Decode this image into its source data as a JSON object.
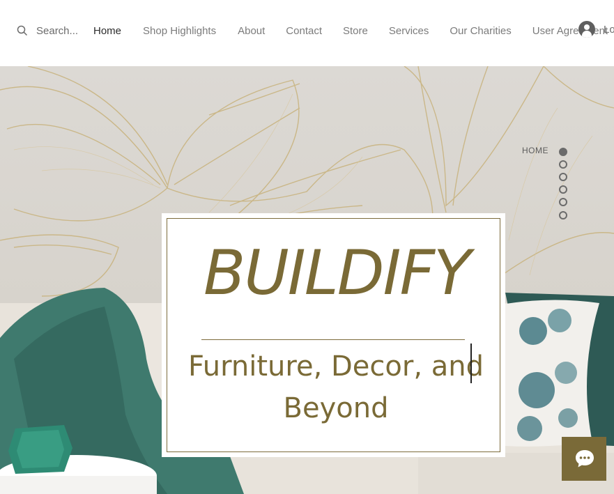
{
  "search": {
    "placeholder": "Search..."
  },
  "nav": {
    "items": [
      {
        "label": "Home",
        "active": true
      },
      {
        "label": "Shop Highlights"
      },
      {
        "label": "About"
      },
      {
        "label": "Contact"
      },
      {
        "label": "Store"
      },
      {
        "label": "Services"
      },
      {
        "label": "Our Charities"
      },
      {
        "label": "User Agreement"
      }
    ]
  },
  "login": {
    "label": "Lo"
  },
  "dot_nav": {
    "active_label": "HOME",
    "count": 6
  },
  "hero": {
    "brand": "BUILDIFY",
    "tagline": "Furniture, Decor, and Beyond"
  },
  "colors": {
    "accent": "#7a6a36",
    "chat_bg": "#7a6a38",
    "text_nav": "#7b7b7b"
  },
  "icons": [
    "search-icon",
    "user-avatar-icon",
    "chat-icon"
  ]
}
